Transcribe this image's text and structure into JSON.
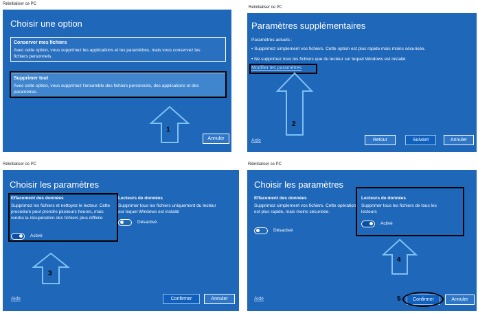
{
  "caption": "Réinitialiser ce PC",
  "p1": {
    "title": "Choisir une option",
    "opt1_title": "Conserver mes fichiers",
    "opt1_desc": "Avec cette option, vous supprimez les applications et les paramètres, mais vous conservez les fichiers personnels.",
    "opt2_title": "Supprimer tout",
    "opt2_desc": "Avec cette option, vous supprimez l'ensemble des fichiers personnels, des applications et des paramètres.",
    "cancel": "Annuler",
    "step": "1"
  },
  "p2": {
    "title": "Paramètres supplémentaires",
    "current_label": "Paramètres actuels :",
    "bullet1": "• Supprimez simplement vos fichiers. Cette option est plus rapide mais moins sécurisée.",
    "bullet2": "• Ne supprimez tous les fichiers que du lecteur sur lequel Windows est installé",
    "modify_link": "Modifier les paramètres",
    "help": "Aide",
    "back": "Retour",
    "next": "Suivant",
    "cancel": "Annuler",
    "step": "2"
  },
  "p3": {
    "title": "Choisir les paramètres",
    "erase_title": "Effacement des données",
    "erase_desc": "Supprimez les fichiers et nettoyez le lecteur. Cette procédure peut prendre plusieurs heures, mais rendra la récupération des fichiers plus difficile",
    "erase_state": "Activé",
    "drives_title": "Lecteurs de données",
    "drives_desc": "Supprimer tous les fichiers uniquement du lecteur sur lequel Windows est installé",
    "drives_state": "Désactivé",
    "help": "Aide",
    "confirm": "Confirmer",
    "cancel": "Annuler",
    "step": "3"
  },
  "p4": {
    "title": "Choisir les paramètres",
    "erase_title": "Effacement des données",
    "erase_desc": "Supprimez simplement vos fichiers. Cette opération est plus rapide, mais moins sécurisée.",
    "erase_state": "Désactivé",
    "drives_title": "Lecteurs de données",
    "drives_desc": "Supprimer tous les fichiers de tous les lecteurs",
    "drives_state": "Activé",
    "help": "Aide",
    "confirm": "Confirmer",
    "cancel": "Annuler",
    "step": "4",
    "step5": "5"
  },
  "colors": {
    "panel_blue": "#1f67b8",
    "annotation": "#000000"
  }
}
